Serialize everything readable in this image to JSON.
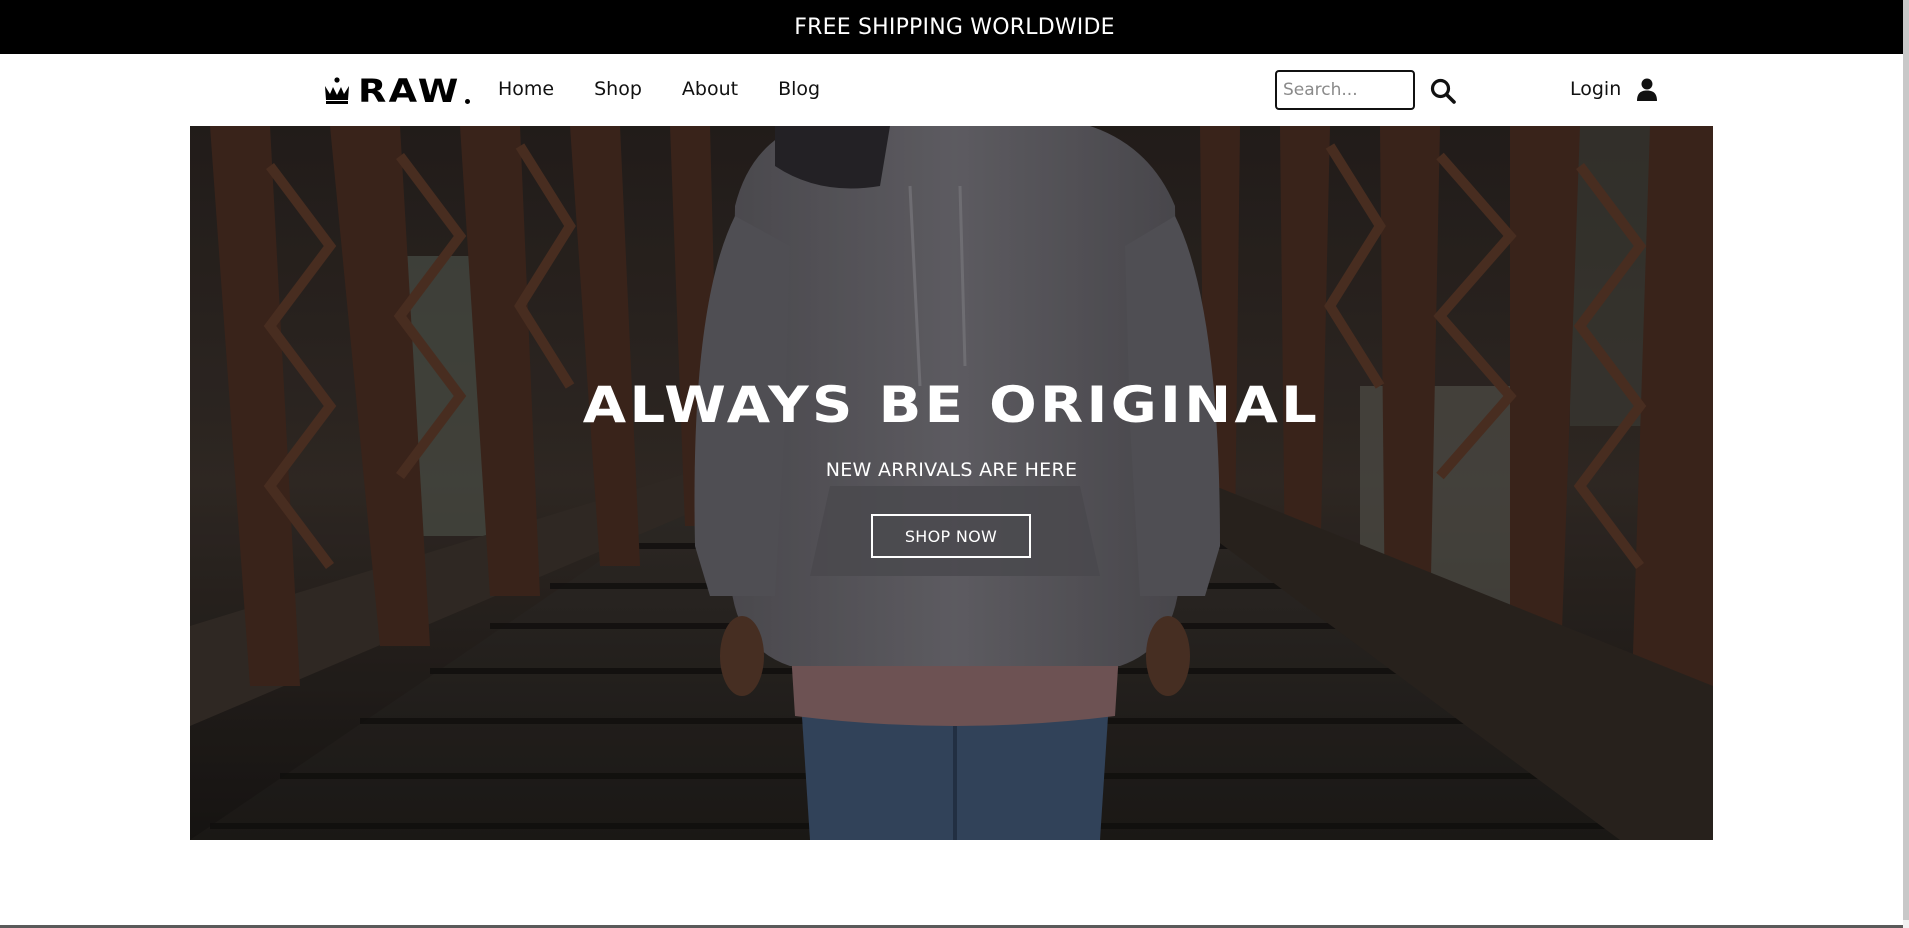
{
  "announcement": {
    "text": "FREE SHIPPING WORLDWIDE"
  },
  "brand": {
    "name": "RAW",
    "logo_icon": "crown-icon"
  },
  "nav": {
    "links": [
      {
        "label": "Home"
      },
      {
        "label": "Shop"
      },
      {
        "label": "About"
      },
      {
        "label": "Blog"
      }
    ]
  },
  "search": {
    "placeholder": "Search...",
    "value": "",
    "icon": "search-icon"
  },
  "account": {
    "login_label": "Login",
    "icon": "user-icon"
  },
  "hero": {
    "title": "ALWAYS BE ORIGINAL",
    "subtitle": "NEW ARRIVALS ARE HERE",
    "cta_label": "SHOP NOW"
  },
  "colors": {
    "announcement_bg": "#000000",
    "text_light": "#ffffff",
    "text_dark": "#111111"
  }
}
